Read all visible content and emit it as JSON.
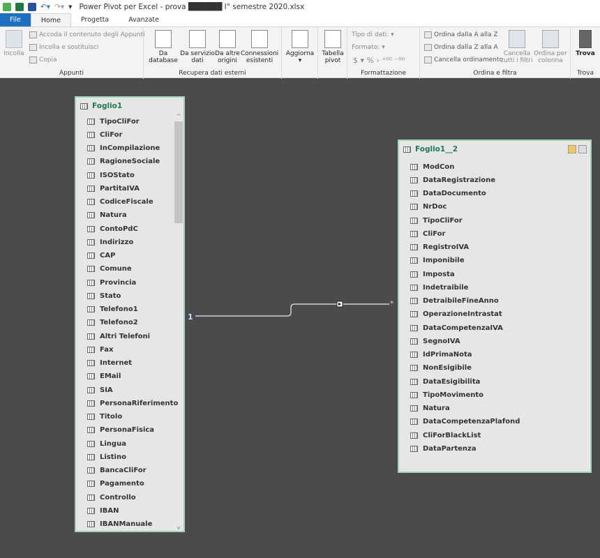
{
  "title": "Power Pivot per Excel - prova ██████ I° semestre 2020.xlsx",
  "tabs": [
    "File",
    "Home",
    "Progetta",
    "Avanzate"
  ],
  "ribbon": {
    "appunti": {
      "paste": "Incolla",
      "append": "Accoda il contenuto degli Appunti",
      "replace": "Incolla e sostituisci",
      "copy": "Copia",
      "label": "Appunti"
    },
    "external": {
      "db": "Da database",
      "service": "Da servizio dati",
      "other": "Da altre origini",
      "existing": "Connessioni esistenti",
      "label": "Recupera dati esterni"
    },
    "refresh": "Aggiorna",
    "pivot": "Tabella pivot",
    "format": {
      "type": "Tipo di dati:",
      "format": "Formato:",
      "symbols": "$ ▾  %  ›  ⁺⁰⁰  ⁻⁰⁰",
      "label": "Formattazione"
    },
    "sort": {
      "az": "Ordina dalla A alla Z",
      "za": "Ordina dalla Z alla A",
      "clear": "Cancella ordinamento",
      "clear_filters": "Cancella tutti i filtri",
      "by_col": "Ordina per colonna",
      "label": "Ordina e filtra"
    },
    "find": {
      "btn": "Trova",
      "label": "Trova"
    }
  },
  "table1": {
    "name": "Foglio1",
    "columns": [
      "TipoCliFor",
      "CliFor",
      "InCompilazione",
      "RagioneSociale",
      "ISOStato",
      "PartitaIVA",
      "CodiceFiscale",
      "Natura",
      "ContoPdC",
      "Indirizzo",
      "CAP",
      "Comune",
      "Provincia",
      "Stato",
      "Telefono1",
      "Telefono2",
      "Altri Telefoni",
      "Fax",
      "Internet",
      "EMail",
      "SIA",
      "PersonaRiferimento",
      "Titolo",
      "PersonaFisica",
      "Lingua",
      "Listino",
      "BancaCliFor",
      "Pagamento",
      "Controllo",
      "IBAN",
      "IBANManuale"
    ]
  },
  "table2": {
    "name": "Foglio1__2",
    "columns": [
      "ModCon",
      "DataRegistrazione",
      "DataDocumento",
      "NrDoc",
      "TipoCliFor",
      "CliFor",
      "RegistroIVA",
      "Imponibile",
      "Imposta",
      "Indetraibile",
      "DetraibileFineAnno",
      "OperazioneIntrastat",
      "DataCompetenzaIVA",
      "SegnoIVA",
      "IdPrimaNota",
      "NonEsigibile",
      "DataEsigibilita",
      "TipoMovimento",
      "Natura",
      "DataCompetenzaPlafond",
      "CliForBlackList",
      "DataPartenza"
    ]
  },
  "relationship": {
    "from": "1",
    "to": "*"
  }
}
